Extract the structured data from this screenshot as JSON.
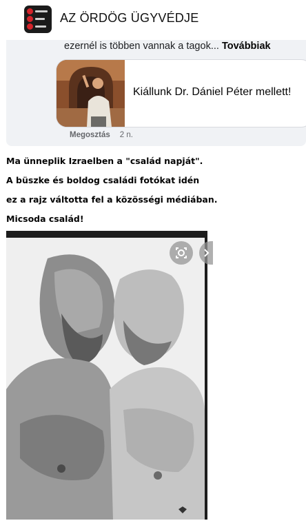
{
  "header": {
    "page_name": "AZ ÖRDÖG ÜGYVÉDJE",
    "avatar_icon": "page-logo-icon"
  },
  "shared_post": {
    "text": "ezernél is többen vannak a tagok... ",
    "see_more": "Továbbiak",
    "link_preview": {
      "title": "Kiállunk Dr. Dániel Péter mellett!"
    },
    "share_label": "Megosztás",
    "time": "2 n."
  },
  "post": {
    "lines": [
      "Ma ünneplik Izraelben a \"család napját\".",
      "A büszke és boldog családi fotókat idén",
      "ez a rajz váltotta fel a közösségi médiában.",
      "Micsoda család!"
    ]
  },
  "image": {
    "lens_icon": "visual-search-icon",
    "next_icon": "chevron-right-icon"
  }
}
